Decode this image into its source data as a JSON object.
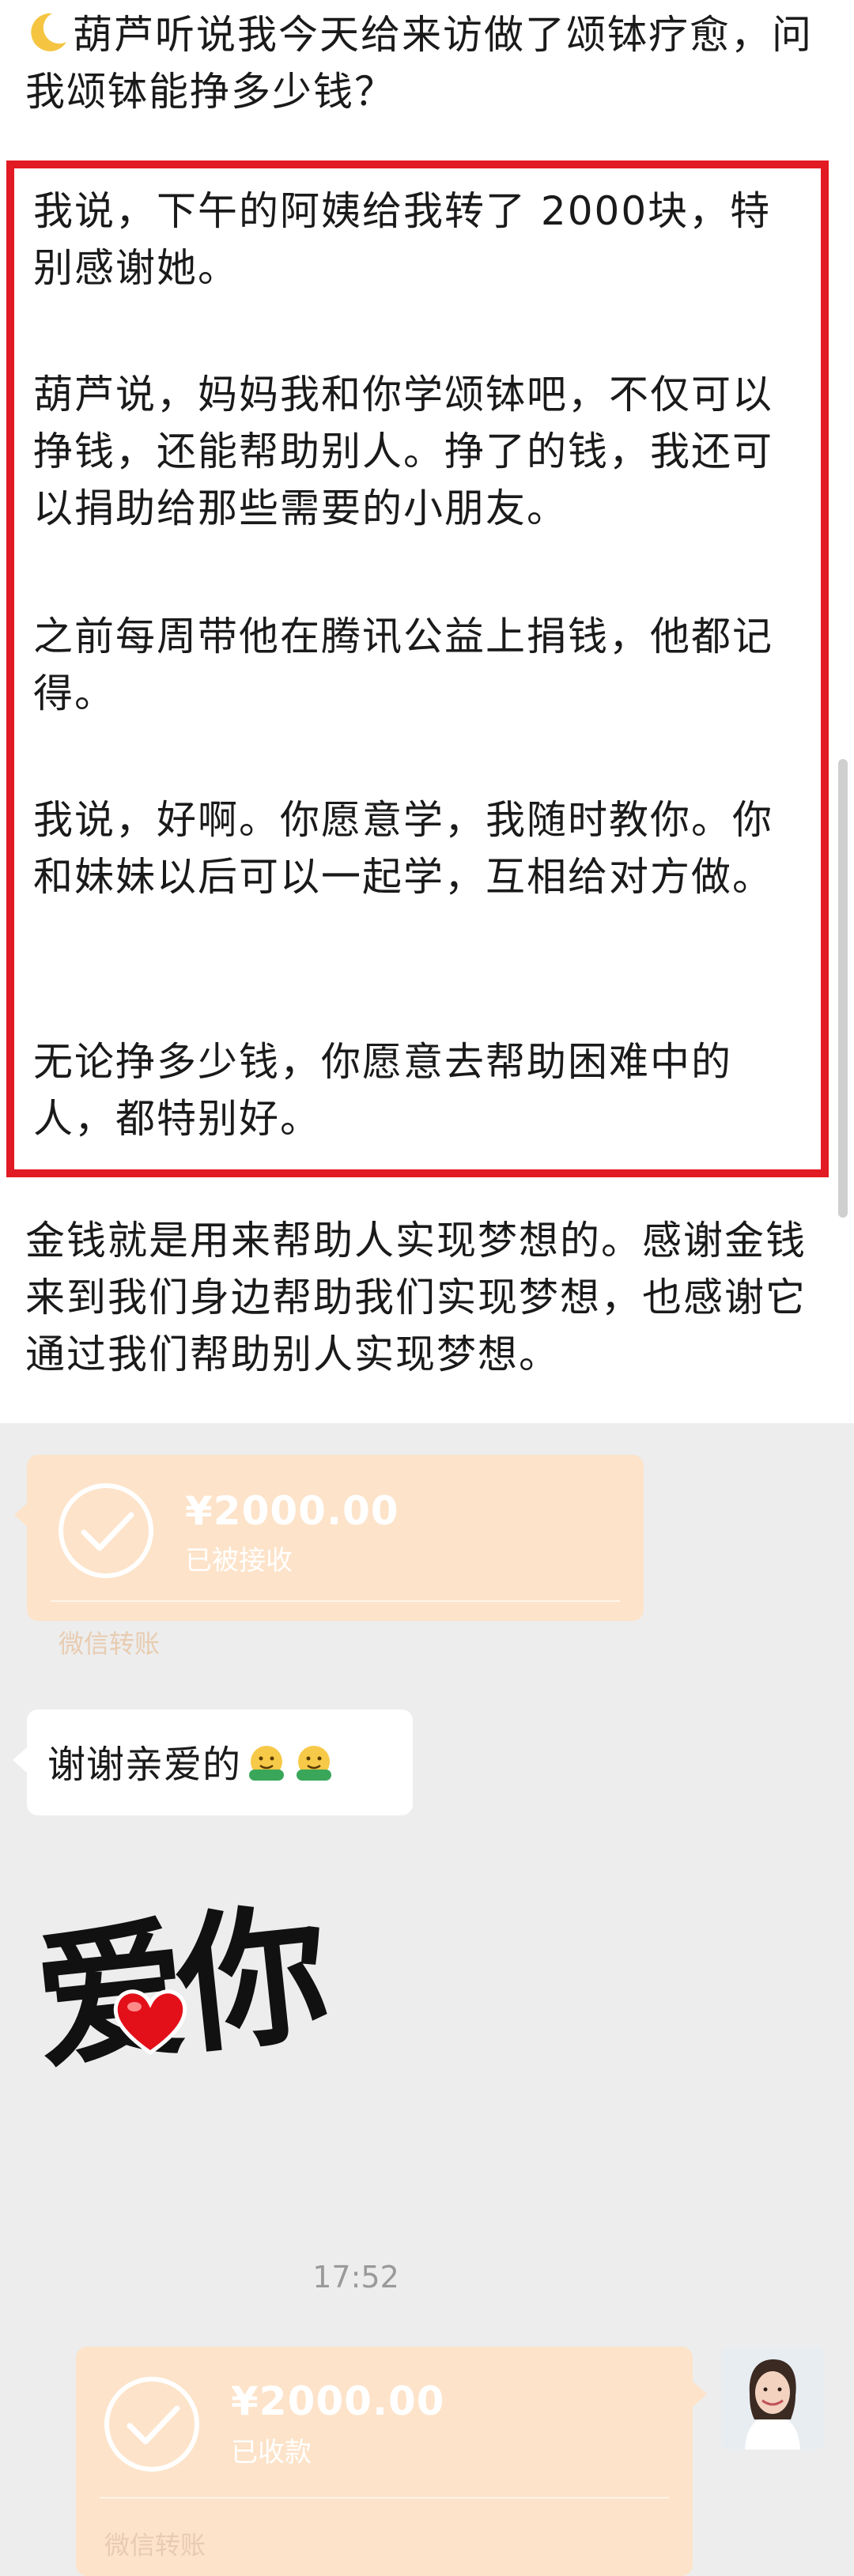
{
  "post": {
    "intro": "葫芦听说我今天给来访做了颂钵疗愈，问我颂钵能挣多少钱？",
    "highlight": [
      "我说，下午的阿姨给我转了 2000块，特别感谢她。",
      "葫芦说，妈妈我和你学颂钵吧，不仅可以挣钱，还能帮助别人。挣了的钱，我还可以捐助给那些需要的小朋友。",
      "之前每周带他在腾讯公益上捐钱，他都记得。",
      "我说，好啊。你愿意学，我随时教你。你和妹妹以后可以一起学，互相给对方做。",
      "无论挣多少钱，你愿意去帮助困难中的人，都特别好。"
    ],
    "closing": "金钱就是用来帮助人实现梦想的。感谢金钱来到我们身边帮助我们实现梦想，也感谢它通过我们帮助别人实现梦想。",
    "highlight_border_color": "#e21a23",
    "intro_icon": "crescent-moon-icon"
  },
  "chat": {
    "transfer_received_by_other": {
      "amount": "¥2000.00",
      "status": "已被接收",
      "label": "微信转账"
    },
    "message": {
      "text": "谢谢亲爱的",
      "emoji": "hug-emoji-icon"
    },
    "sticker": {
      "text": "爱你",
      "heart": "red-heart-icon"
    },
    "timestamp": "17:52",
    "transfer_received_by_me": {
      "amount": "¥2000.00",
      "status": "已收款",
      "label": "微信转账"
    },
    "transfer_color": "#fde3c9",
    "background_color": "#ededed"
  }
}
